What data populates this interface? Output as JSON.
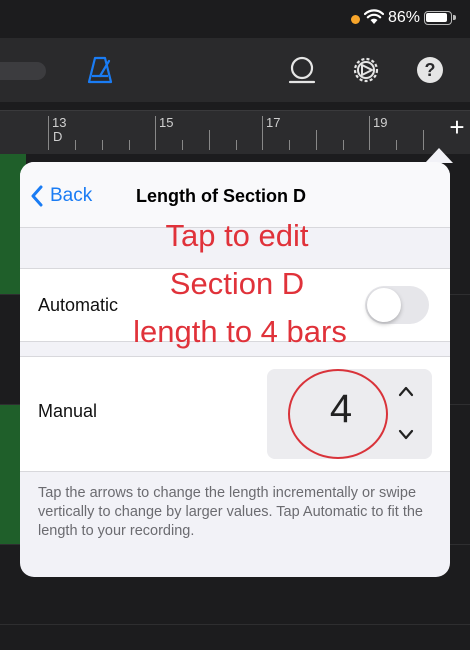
{
  "status_bar": {
    "battery_percent": "86%",
    "dot_color": "#f7a52b"
  },
  "toolbar": {
    "icons": [
      "metronome-icon",
      "loop-icon",
      "settings-icon",
      "help-icon"
    ],
    "help_label": "?",
    "accent": "#1a7cf4"
  },
  "ruler": {
    "bars": [
      "13",
      "15",
      "17",
      "19"
    ],
    "section_marker": "D",
    "add_label": "+"
  },
  "popover": {
    "back_label": "Back",
    "title": "Length of Section D",
    "automatic": {
      "label": "Automatic",
      "on": false
    },
    "manual": {
      "label": "Manual",
      "value": "4"
    },
    "footer": "Tap the arrows to change the length incrementally or swipe vertically to change by larger values. Tap Automatic to fit the length to your recording."
  },
  "annotation": {
    "line1": "Tap to edit",
    "line2": "Section D",
    "line3": "length to 4 bars",
    "color": "#e0323a"
  }
}
